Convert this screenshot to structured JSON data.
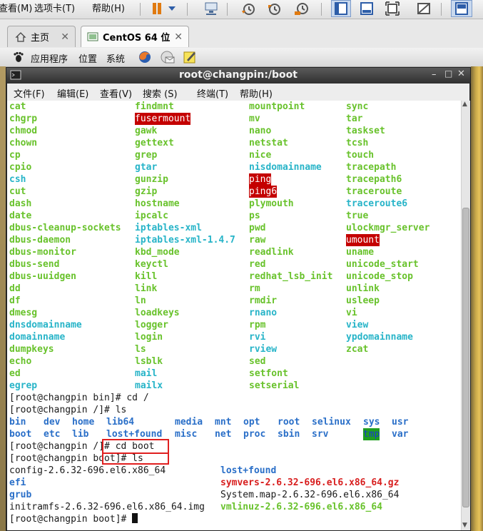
{
  "host_menu": {
    "items": [
      "查看(M)",
      "选项卡(T)",
      "帮助(H)"
    ]
  },
  "host_toolbar": {
    "icons": [
      "pause-icon",
      "dropdown-arrow-icon",
      "network-icon",
      "snapshot-icon",
      "revert-snapshot-icon",
      "snapshot-manager-icon",
      "console-view-icon",
      "normal-view-icon",
      "fullscreen-icon",
      "unity-icon",
      "thumbnail-icon"
    ]
  },
  "tabs": [
    {
      "label": "主页",
      "icon": "home-icon"
    },
    {
      "label": "CentOS 64 位",
      "icon": "vm-icon"
    }
  ],
  "gnome_panel": {
    "applications": "应用程序",
    "places": "位置",
    "system": "系统"
  },
  "terminal": {
    "title": "root@changpin:/boot",
    "menu": [
      "文件(F)",
      "编辑(E)",
      "查看(V)",
      "搜索 (S)",
      "终端(T)",
      "帮助(H)"
    ]
  },
  "colors": {
    "exec_green": "#68c22b",
    "link_cyan": "#27b4c8",
    "dir_blue": "#2a6fc8",
    "archive_red": "#d81e1e",
    "setuid_bg": "#c40000",
    "sticky_bg": "#1f9e1f",
    "highlight_box": "#e01f1f"
  },
  "bin_listing": [
    [
      {
        "t": "cat",
        "c": "green"
      },
      {
        "t": "findmnt",
        "c": "green"
      },
      {
        "t": "mountpoint",
        "c": "green"
      },
      {
        "t": "sync",
        "c": "green"
      }
    ],
    [
      {
        "t": "chgrp",
        "c": "green"
      },
      {
        "t": "fusermount",
        "c": "hl-red"
      },
      {
        "t": "mv",
        "c": "green"
      },
      {
        "t": "tar",
        "c": "green"
      }
    ],
    [
      {
        "t": "chmod",
        "c": "green"
      },
      {
        "t": "gawk",
        "c": "green"
      },
      {
        "t": "nano",
        "c": "green"
      },
      {
        "t": "taskset",
        "c": "green"
      }
    ],
    [
      {
        "t": "chown",
        "c": "green"
      },
      {
        "t": "gettext",
        "c": "green"
      },
      {
        "t": "netstat",
        "c": "green"
      },
      {
        "t": "tcsh",
        "c": "green"
      }
    ],
    [
      {
        "t": "cp",
        "c": "green"
      },
      {
        "t": "grep",
        "c": "green"
      },
      {
        "t": "nice",
        "c": "green"
      },
      {
        "t": "touch",
        "c": "green"
      }
    ],
    [
      {
        "t": "cpio",
        "c": "green"
      },
      {
        "t": "gtar",
        "c": "cyan"
      },
      {
        "t": "nisdomainname",
        "c": "cyan"
      },
      {
        "t": "tracepath",
        "c": "green"
      }
    ],
    [
      {
        "t": "csh",
        "c": "cyan"
      },
      {
        "t": "gunzip",
        "c": "green"
      },
      {
        "t": "ping",
        "c": "hl-red"
      },
      {
        "t": "tracepath6",
        "c": "green"
      }
    ],
    [
      {
        "t": "cut",
        "c": "green"
      },
      {
        "t": "gzip",
        "c": "green"
      },
      {
        "t": "ping6",
        "c": "hl-red"
      },
      {
        "t": "traceroute",
        "c": "green"
      }
    ],
    [
      {
        "t": "dash",
        "c": "green"
      },
      {
        "t": "hostname",
        "c": "green"
      },
      {
        "t": "plymouth",
        "c": "green"
      },
      {
        "t": "traceroute6",
        "c": "cyan"
      }
    ],
    [
      {
        "t": "date",
        "c": "green"
      },
      {
        "t": "ipcalc",
        "c": "green"
      },
      {
        "t": "ps",
        "c": "green"
      },
      {
        "t": "true",
        "c": "green"
      }
    ],
    [
      {
        "t": "dbus-cleanup-sockets",
        "c": "green"
      },
      {
        "t": "iptables-xml",
        "c": "cyan"
      },
      {
        "t": "pwd",
        "c": "green"
      },
      {
        "t": "ulockmgr_server",
        "c": "green"
      }
    ],
    [
      {
        "t": "dbus-daemon",
        "c": "green"
      },
      {
        "t": "iptables-xml-1.4.7",
        "c": "cyan"
      },
      {
        "t": "raw",
        "c": "green"
      },
      {
        "t": "umount",
        "c": "hl-red"
      }
    ],
    [
      {
        "t": "dbus-monitor",
        "c": "green"
      },
      {
        "t": "kbd_mode",
        "c": "green"
      },
      {
        "t": "readlink",
        "c": "green"
      },
      {
        "t": "uname",
        "c": "green"
      }
    ],
    [
      {
        "t": "dbus-send",
        "c": "green"
      },
      {
        "t": "keyctl",
        "c": "green"
      },
      {
        "t": "red",
        "c": "green"
      },
      {
        "t": "unicode_start",
        "c": "green"
      }
    ],
    [
      {
        "t": "dbus-uuidgen",
        "c": "green"
      },
      {
        "t": "kill",
        "c": "green"
      },
      {
        "t": "redhat_lsb_init",
        "c": "green"
      },
      {
        "t": "unicode_stop",
        "c": "green"
      }
    ],
    [
      {
        "t": "dd",
        "c": "green"
      },
      {
        "t": "link",
        "c": "green"
      },
      {
        "t": "rm",
        "c": "green"
      },
      {
        "t": "unlink",
        "c": "green"
      }
    ],
    [
      {
        "t": "df",
        "c": "green"
      },
      {
        "t": "ln",
        "c": "green"
      },
      {
        "t": "rmdir",
        "c": "green"
      },
      {
        "t": "usleep",
        "c": "green"
      }
    ],
    [
      {
        "t": "dmesg",
        "c": "green"
      },
      {
        "t": "loadkeys",
        "c": "green"
      },
      {
        "t": "rnano",
        "c": "cyan"
      },
      {
        "t": "vi",
        "c": "green"
      }
    ],
    [
      {
        "t": "dnsdomainname",
        "c": "cyan"
      },
      {
        "t": "logger",
        "c": "green"
      },
      {
        "t": "rpm",
        "c": "green"
      },
      {
        "t": "view",
        "c": "cyan"
      }
    ],
    [
      {
        "t": "domainname",
        "c": "cyan"
      },
      {
        "t": "login",
        "c": "green"
      },
      {
        "t": "rvi",
        "c": "cyan"
      },
      {
        "t": "ypdomainname",
        "c": "cyan"
      }
    ],
    [
      {
        "t": "dumpkeys",
        "c": "green"
      },
      {
        "t": "ls",
        "c": "green"
      },
      {
        "t": "rview",
        "c": "cyan"
      },
      {
        "t": "zcat",
        "c": "green"
      }
    ],
    [
      {
        "t": "echo",
        "c": "green"
      },
      {
        "t": "lsblk",
        "c": "green"
      },
      {
        "t": "sed",
        "c": "green"
      },
      {
        "t": "",
        "c": "green"
      }
    ],
    [
      {
        "t": "ed",
        "c": "green"
      },
      {
        "t": "mail",
        "c": "cyan"
      },
      {
        "t": "setfont",
        "c": "green"
      },
      {
        "t": "",
        "c": "green"
      }
    ],
    [
      {
        "t": "egrep",
        "c": "cyan"
      },
      {
        "t": "mailx",
        "c": "cyan"
      },
      {
        "t": "setserial",
        "c": "green"
      },
      {
        "t": "",
        "c": "green"
      }
    ]
  ],
  "cmd1": "[root@changpin bin]# cd /",
  "cmd2": "[root@changpin /]# ls",
  "root_listing": [
    [
      {
        "t": "bin",
        "c": "blue"
      },
      {
        "t": "dev",
        "c": "blue"
      },
      {
        "t": "home",
        "c": "blue"
      },
      {
        "t": "lib64",
        "c": "blue"
      },
      {
        "t": "media",
        "c": "blue"
      },
      {
        "t": "mnt",
        "c": "blue"
      },
      {
        "t": "opt",
        "c": "blue"
      },
      {
        "t": "root",
        "c": "blue"
      },
      {
        "t": "selinux",
        "c": "blue"
      },
      {
        "t": "sys",
        "c": "blue"
      },
      {
        "t": "usr",
        "c": "blue"
      }
    ],
    [
      {
        "t": "boot",
        "c": "blue"
      },
      {
        "t": "etc",
        "c": "blue"
      },
      {
        "t": "lib",
        "c": "blue"
      },
      {
        "t": "lost+found",
        "c": "blue"
      },
      {
        "t": "misc",
        "c": "blue"
      },
      {
        "t": "net",
        "c": "blue"
      },
      {
        "t": "proc",
        "c": "blue"
      },
      {
        "t": "sbin",
        "c": "blue"
      },
      {
        "t": "srv",
        "c": "blue"
      },
      {
        "t": "tmp",
        "c": "hl-green"
      },
      {
        "t": "var",
        "c": "blue"
      }
    ]
  ],
  "cmd3": "[root@changpin /]# cd boot",
  "cmd4": "[root@changpin boot]# ls",
  "boot_listing": [
    [
      {
        "t": "config-2.6.32-696.el6.x86_64",
        "c": "black"
      },
      {
        "t": "lost+found",
        "c": "blue"
      }
    ],
    [
      {
        "t": "efi",
        "c": "blue"
      },
      {
        "t": "symvers-2.6.32-696.el6.x86_64.gz",
        "c": "red"
      }
    ],
    [
      {
        "t": "grub",
        "c": "blue"
      },
      {
        "t": "System.map-2.6.32-696.el6.x86_64",
        "c": "black"
      }
    ],
    [
      {
        "t": "initramfs-2.6.32-696.el6.x86_64.img",
        "c": "black"
      },
      {
        "t": "vmlinuz-2.6.32-696.el6.x86_64",
        "c": "green"
      }
    ]
  ],
  "prompt": "[root@changpin boot]# "
}
